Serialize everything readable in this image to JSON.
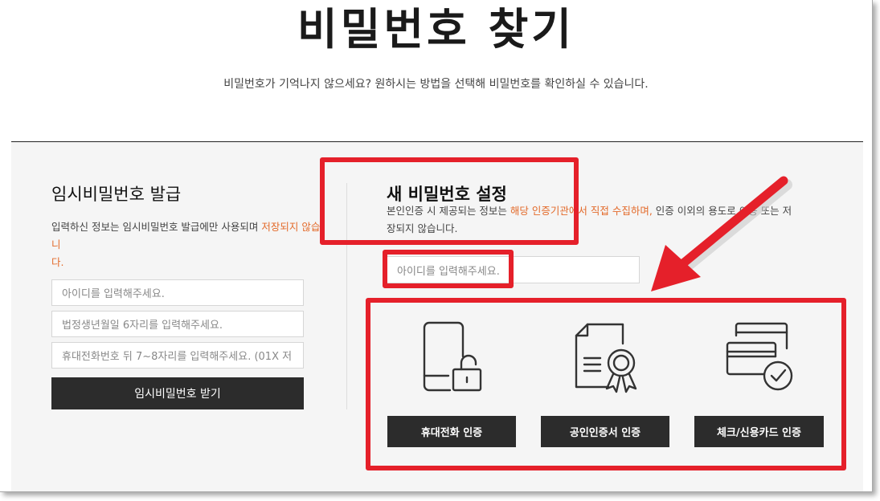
{
  "page": {
    "title": "비밀번호 찾기",
    "subtitle": "비밀번호가 기억나지 않으세요? 원하시는 방법을 선택해 비밀번호를 확인하실 수 있습니다."
  },
  "temp_password": {
    "heading": "임시비밀번호 발급",
    "desc_prefix": "입력하신 정보는 임시비밀번호 발급에만 사용되며 ",
    "desc_highlight_1": "저장되지 않습니",
    "desc_highlight_2": "다.",
    "id_placeholder": "아이디를 입력해주세요.",
    "birth_placeholder": "법정생년월일 6자리를 입력해주세요.",
    "phone_placeholder": "휴대전화번호 뒤 7~8자리를 입력해주세요. (01X 저",
    "submit_label": "임시비밀번호 받기"
  },
  "new_password": {
    "heading": "새 비밀번호 설정",
    "desc_prefix": "본인인증 시 제공되는 정보는 ",
    "desc_highlight": "해당 인증기관에서 직접 수집하며,",
    "desc_suffix": " 인증 이외의 용도로 이용 또는 저",
    "desc_line2": "장되지 않습니다.",
    "id_placeholder": "아이디를 입력해주세요.",
    "methods": [
      {
        "icon": "phone-lock-icon",
        "label": "휴대전화 인증"
      },
      {
        "icon": "certificate-icon",
        "label": "공인인증서 인증"
      },
      {
        "icon": "credit-card-check-icon",
        "label": "체크/신용카드 인증"
      }
    ]
  },
  "colors": {
    "highlight": "#e36a2a",
    "button": "#2c2c2c",
    "annotation": "#e5202a"
  }
}
